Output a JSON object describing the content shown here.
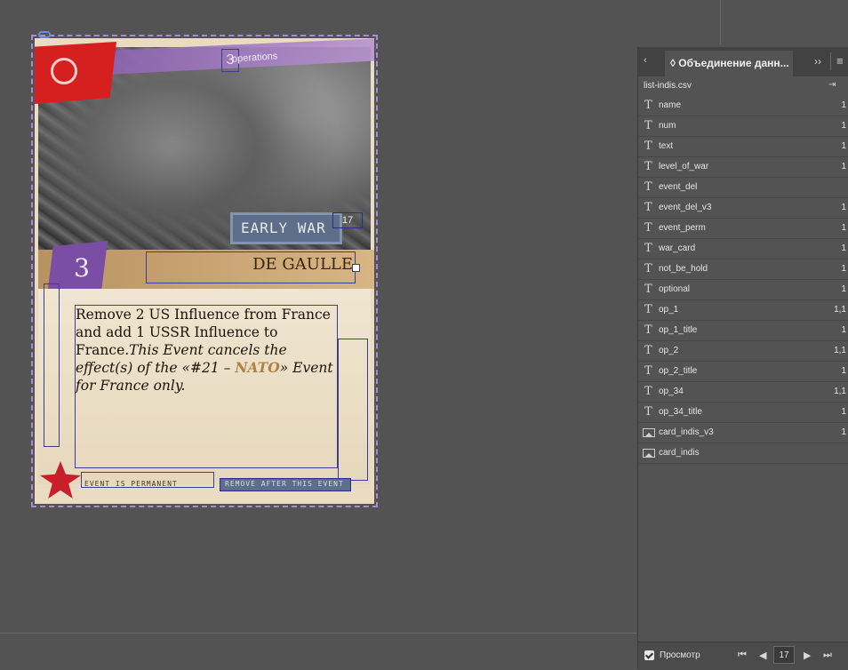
{
  "card": {
    "ops_num": "3",
    "ops_label": "operations",
    "era": "EARLY WAR",
    "era_num": "17",
    "op_value": "3",
    "name": "DE GAULLE",
    "text_plain": "Remove 2 US Influence from France and add 1 USSR Influence to France.",
    "text_italic_1": "This Event cancels the effect(s) of the «#21 – ",
    "text_nato": "NATO",
    "text_italic_2": "» Event for France only.",
    "remain": "EVENT IS PERMANENT",
    "discard": "REMOVE AFTER THIS EVENT"
  },
  "panel": {
    "tab_title": "Объединение данн...",
    "file": "list-indis.csv",
    "fields": [
      {
        "type": "text",
        "name": "name",
        "value": "1"
      },
      {
        "type": "text",
        "name": "num",
        "value": "1"
      },
      {
        "type": "text",
        "name": "text",
        "value": "1"
      },
      {
        "type": "text",
        "name": "level_of_war",
        "value": "1"
      },
      {
        "type": "text",
        "name": "event_del",
        "value": ""
      },
      {
        "type": "text",
        "name": "event_del_v3",
        "value": "1"
      },
      {
        "type": "text",
        "name": "event_perm",
        "value": "1"
      },
      {
        "type": "text",
        "name": "war_card",
        "value": "1"
      },
      {
        "type": "text",
        "name": "not_be_hold",
        "value": "1"
      },
      {
        "type": "text",
        "name": "optional",
        "value": "1"
      },
      {
        "type": "text",
        "name": "op_1",
        "value": "1,1"
      },
      {
        "type": "text",
        "name": "op_1_title",
        "value": "1"
      },
      {
        "type": "text",
        "name": "op_2",
        "value": "1,1"
      },
      {
        "type": "text",
        "name": "op_2_title",
        "value": "1"
      },
      {
        "type": "text",
        "name": "op_34",
        "value": "1,1"
      },
      {
        "type": "text",
        "name": "op_34_title",
        "value": "1"
      },
      {
        "type": "image",
        "name": "card_indis_v3",
        "value": "1"
      },
      {
        "type": "image",
        "name": "card_indis",
        "value": ""
      }
    ],
    "footer": {
      "preview": "Просмотр",
      "page": "17"
    }
  },
  "colors": {
    "canvas": "#535353",
    "panel_bg": "#535353",
    "frame": "#3d3d8e",
    "card_outline": "#a78bda"
  },
  "icons": [
    "link-icon",
    "text-field-icon",
    "image-field-icon",
    "create-merged-icon",
    "first-page-icon",
    "prev-page-icon",
    "next-page-icon",
    "last-page-icon",
    "preview-checkbox"
  ]
}
